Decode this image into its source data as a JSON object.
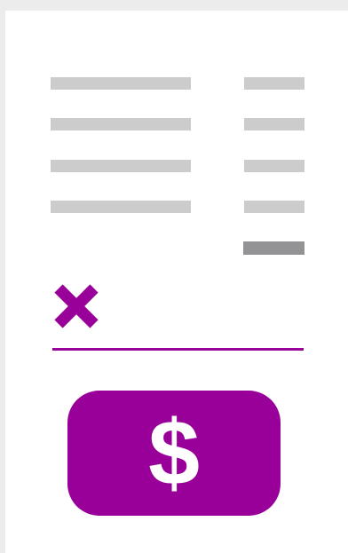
{
  "colors": {
    "accent": "#990099",
    "placeholder_line": "#cccccc",
    "total_line": "#939396",
    "card_background": "#ffffff",
    "page_background": "#ececec"
  },
  "receipt": {
    "line_item_rows": 4,
    "cancel_icon": "x-icon",
    "pay_button": {
      "icon": "dollar-icon",
      "symbol": "$"
    }
  }
}
